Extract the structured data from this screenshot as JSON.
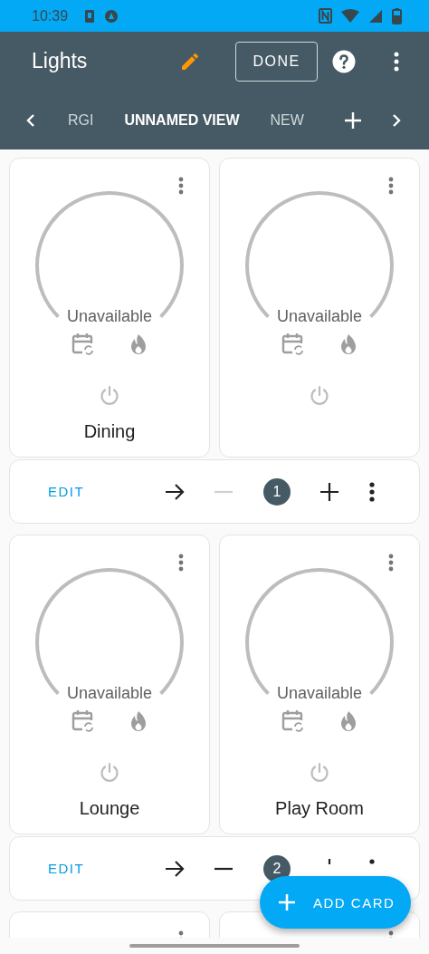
{
  "status_bar": {
    "time": "10:39"
  },
  "toolbar": {
    "title": "Lights",
    "done_button": "DONE"
  },
  "tabs": [
    {
      "label": "RGI",
      "selected": false
    },
    {
      "label": "UNNAMED VIEW",
      "selected": true
    },
    {
      "label": "NEW",
      "selected": false
    }
  ],
  "groups": [
    {
      "edit": "EDIT",
      "badge": "1",
      "minus_disabled": true,
      "cards": [
        {
          "kind": "thermostat",
          "state": "Unavailable",
          "name": "Dining"
        },
        {
          "kind": "thermostat",
          "state": "Unavailable"
        }
      ]
    },
    {
      "edit": "EDIT",
      "badge": "2",
      "minus_disabled": false,
      "under_fab": true,
      "cards": [
        {
          "kind": "thermostat",
          "state": "Unavailable",
          "name": "Lounge"
        },
        {
          "kind": "thermostat",
          "state": "Unavailable",
          "name": "Play Room"
        }
      ]
    },
    {
      "cards": [
        {
          "kind": "thermostat"
        },
        {
          "kind": "thermostat"
        }
      ]
    }
  ],
  "fab": {
    "label": "ADD CARD"
  }
}
